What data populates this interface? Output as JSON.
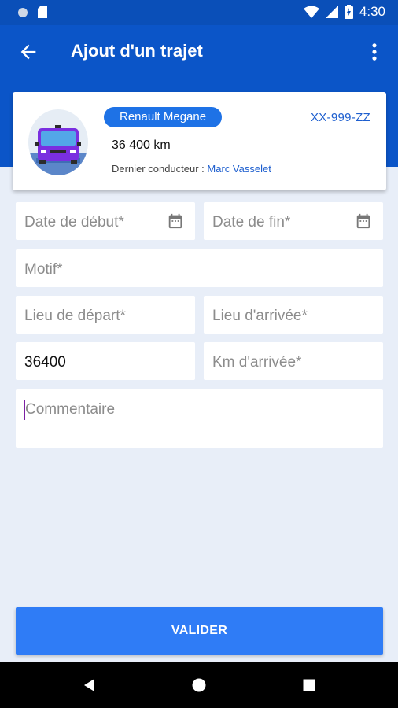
{
  "status_bar": {
    "time": "4:30",
    "icons": [
      "circle-icon",
      "sim-card-icon",
      "wifi-icon",
      "signal-icon",
      "battery-charging-icon"
    ]
  },
  "app_bar": {
    "title": "Ajout d'un trajet",
    "icons": [
      "arrow-back-icon",
      "more-vert-icon"
    ]
  },
  "vehicle": {
    "model": "Renault Megane",
    "plate": "XX-999-ZZ",
    "mileage": "36 400 km",
    "driver_label": "Dernier conducteur :",
    "driver_name": "Marc Vasselet"
  },
  "form": {
    "date_debut": {
      "placeholder": "Date de début*",
      "value": ""
    },
    "date_fin": {
      "placeholder": "Date de fin*",
      "value": ""
    },
    "motif": {
      "placeholder": "Motif*",
      "value": ""
    },
    "lieu_depart": {
      "placeholder": "Lieu de départ*",
      "value": ""
    },
    "lieu_arrivee": {
      "placeholder": "Lieu d'arrivée*",
      "value": ""
    },
    "km_depart": {
      "placeholder": "",
      "value": "36400"
    },
    "km_arrivee": {
      "placeholder": "Km d'arrivée*",
      "value": ""
    },
    "commentaire": {
      "placeholder": "Commentaire",
      "value": ""
    }
  },
  "submit_label": "VALIDER",
  "colors": {
    "primary": "#0b55c8",
    "accent": "#2f7cf6",
    "badge": "#1e72e6",
    "link": "#1e5fcf",
    "background": "#e8eef8"
  }
}
